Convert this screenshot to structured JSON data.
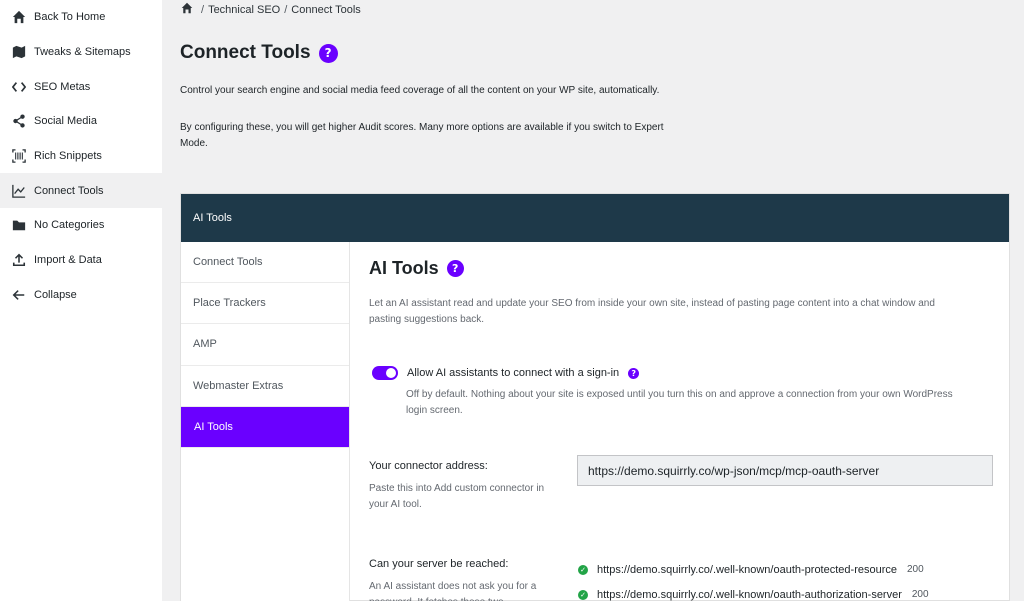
{
  "sidebar": {
    "items": [
      {
        "label": "Back To Home",
        "icon": "home-icon"
      },
      {
        "label": "Tweaks & Sitemaps",
        "icon": "map-icon"
      },
      {
        "label": "SEO Metas",
        "icon": "code-icon"
      },
      {
        "label": "Social Media",
        "icon": "share-icon"
      },
      {
        "label": "Rich Snippets",
        "icon": "barcode-icon"
      },
      {
        "label": "Connect Tools",
        "icon": "chart-line-icon",
        "active": true
      },
      {
        "label": "No Categories",
        "icon": "folder-icon"
      },
      {
        "label": "Import & Data",
        "icon": "upload-icon"
      },
      {
        "label": "Collapse",
        "icon": "arrow-left-icon"
      }
    ]
  },
  "breadcrumb": {
    "items": [
      "Technical SEO",
      "Connect Tools"
    ],
    "separator": "/"
  },
  "page": {
    "title": "Connect Tools",
    "help": "?",
    "desc1": "Control your search engine and social media feed coverage of all the content on your WP site, automatically.",
    "desc2": "By configuring these, you will get higher Audit scores. Many more options are available if you switch to Expert Mode."
  },
  "panel": {
    "header": "AI Tools",
    "tabs": [
      {
        "label": "Connect Tools"
      },
      {
        "label": "Place Trackers"
      },
      {
        "label": "AMP"
      },
      {
        "label": "Webmaster Extras"
      },
      {
        "label": "AI Tools",
        "active": true
      }
    ]
  },
  "content": {
    "title": "AI Tools",
    "help": "?",
    "desc": "Let an AI assistant read and update your SEO from inside your own site, instead of pasting page content into a chat window and pasting suggestions back.",
    "toggle": {
      "label": "Allow AI assistants to connect with a sign-in",
      "on": true,
      "help": "?",
      "note": "Off by default. Nothing about your site is exposed until you turn this on and approve a connection from your own WordPress login screen."
    },
    "connector": {
      "label": "Your connector address:",
      "help": "Paste this into Add custom connector in your AI tool.",
      "value": "https://demo.squirrly.co/wp-json/mcp/mcp-oauth-server"
    },
    "reach": {
      "label": "Can your server be reached:",
      "help": "An AI assistant does not ask you for a password. It fetches these two",
      "items": [
        {
          "url": "https://demo.squirrly.co/.well-known/oauth-protected-resource",
          "code": "200"
        },
        {
          "url": "https://demo.squirrly.co/.well-known/oauth-authorization-server",
          "code": "200"
        }
      ]
    }
  },
  "colors": {
    "accent": "#6a00ff",
    "header_bg": "#1e3949",
    "success": "#22a447"
  }
}
